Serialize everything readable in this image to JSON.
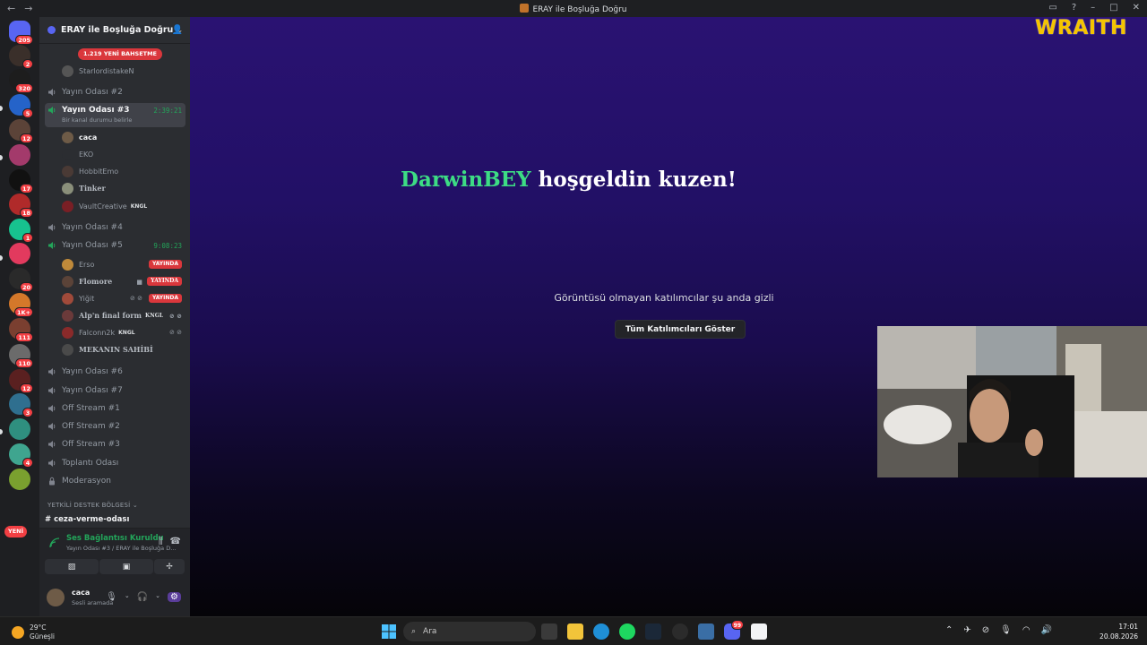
{
  "window": {
    "title": "ERAY ile Boşluğa Doğru",
    "back_icon": "←",
    "forward_icon": "→"
  },
  "server": {
    "name": "ERAY ile Boşluğa Doğru",
    "mention_badge": "1.219 YENİ BAHSETME",
    "yeni_badge": "YENİ"
  },
  "rail_badges": [
    "205",
    "2",
    "320",
    "5",
    "12",
    "",
    "",
    "17",
    "18",
    "1",
    "",
    "20",
    "1K+",
    "111",
    "110",
    "12",
    "3",
    "",
    "4",
    ""
  ],
  "channels": {
    "top_user": "StarlordistakeN",
    "yayin2": "Yayın Odası #2",
    "yayin3": "Yayın Odası #3",
    "yayin3_timer": "2:39:21",
    "yayin3_status": "Bir kanal durumu belirle",
    "yayin3_users": [
      {
        "name": "caca",
        "tag": "",
        "live": ""
      },
      {
        "name": "EKO",
        "tag": "",
        "live": ""
      },
      {
        "name": "HobbitEmo",
        "tag": "",
        "live": ""
      },
      {
        "name": "Tinker",
        "tag": "",
        "live": ""
      },
      {
        "name": "VaultCreative",
        "tag": "KNGL",
        "live": ""
      }
    ],
    "yayin4": "Yayın Odası #4",
    "yayin5": "Yayın Odası #5",
    "yayin5_timer": "9:08:23",
    "yayin5_users": [
      {
        "name": "Erso",
        "tag": "",
        "live": "YAYINDA"
      },
      {
        "name": "Flomore",
        "tag": "",
        "live": "YAYINDA"
      },
      {
        "name": "Yiğit",
        "tag": "",
        "live": "YAYINDA"
      },
      {
        "name": "Alp'n final form",
        "tag": "KNGL",
        "live": ""
      },
      {
        "name": "Falconn2k",
        "tag": "KNGL",
        "live": ""
      },
      {
        "name": "MEKANIN SAHİBİ",
        "tag": "",
        "live": ""
      }
    ],
    "yayin6": "Yayın Odası #6",
    "yayin7": "Yayın Odası #7",
    "off1": "Off Stream #1",
    "off2": "Off Stream #2",
    "off3": "Off Stream #3",
    "toplanti": "Toplantı Odası",
    "moderasyon": "Moderasyon",
    "category": "YETKİLİ DESTEK BÖLGESİ",
    "text_channel": "ceza-verme-odası"
  },
  "voice": {
    "status": "Ses Bağlantısı Kuruldu",
    "location": "Yayın Odası #3 / ERAY ile Boşluğa D..."
  },
  "user": {
    "name": "caca",
    "status": "Sesli aramada"
  },
  "stage": {
    "greet_name": "DarwinBEY",
    "greet_text": "hoşgeldin kuzen!",
    "hidden_text": "Görüntüsü olmayan katılımcılar şu anda gizli",
    "show_all": "Tüm Katılımcıları Göster",
    "logo": "WRAITH"
  },
  "taskbar": {
    "temp": "29°C",
    "weather": "Güneşli",
    "search": "Ara",
    "time": "17:01",
    "date": "20.08.2026",
    "discord_badge": "99"
  },
  "colors": {
    "accent": "#5865f2",
    "online": "#23a55a",
    "live": "#da373c",
    "greet_name": "#3ddc84",
    "logo": "#f5c400"
  }
}
